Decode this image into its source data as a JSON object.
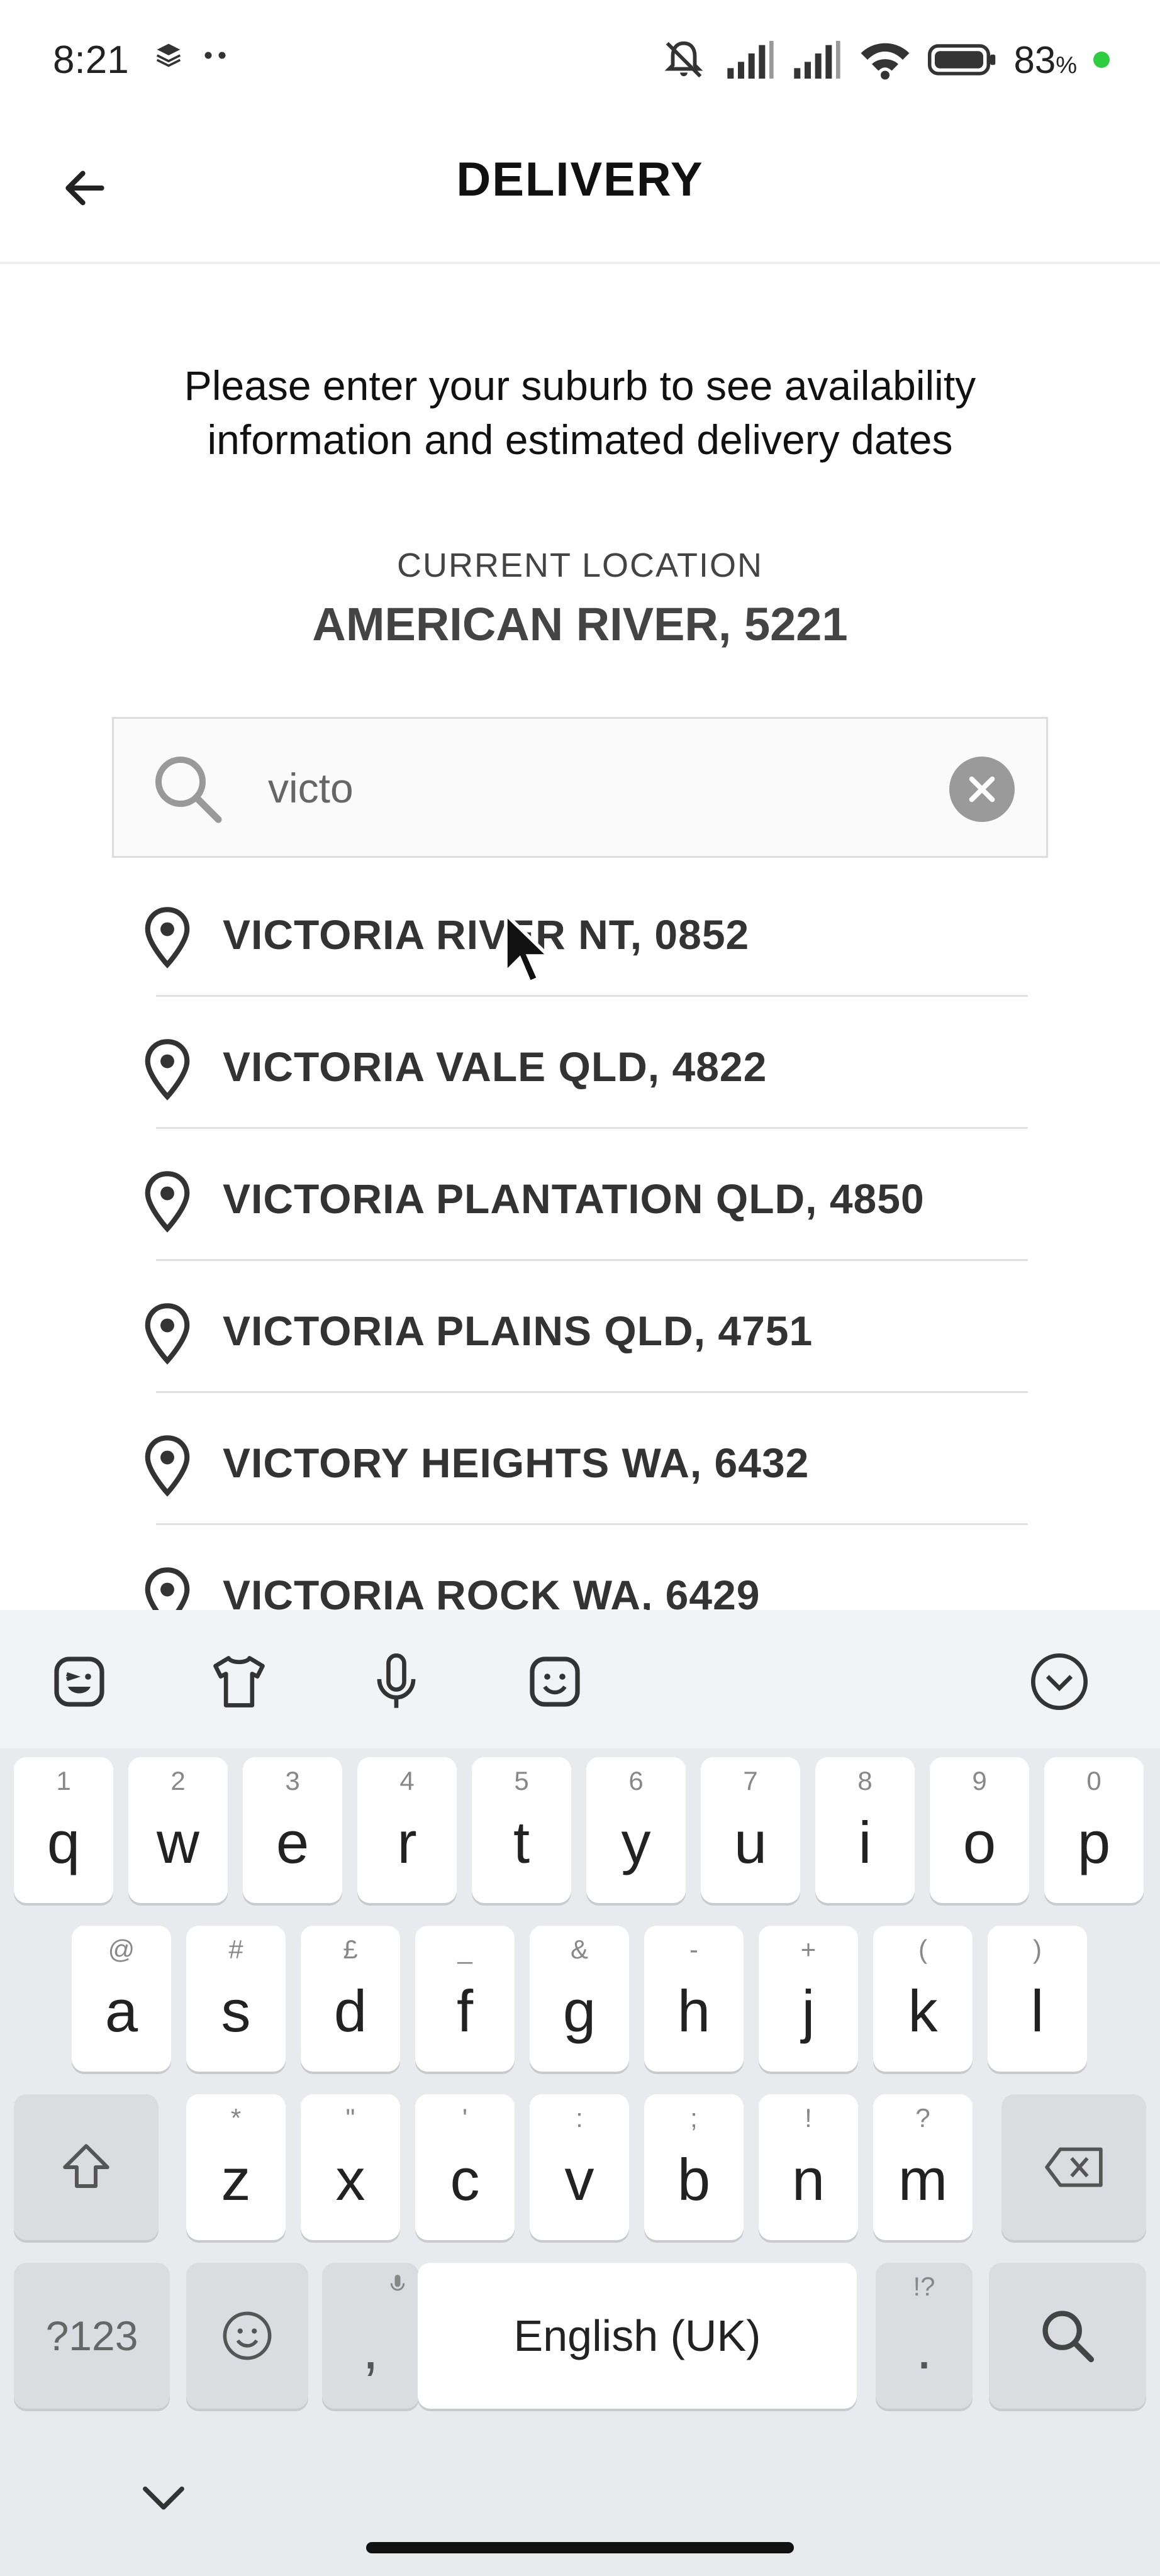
{
  "status_bar": {
    "time": "8:21",
    "battery": "83",
    "battery_unit": "%",
    "icons": [
      "layers-icon",
      "more-dots-icon",
      "mute-icon",
      "signal-icon",
      "signal-icon",
      "wifi-icon",
      "battery-icon"
    ]
  },
  "header": {
    "title": "DELIVERY",
    "back_icon": "arrow-left-icon"
  },
  "intro": {
    "text": "Please enter your suburb to see availability information and estimated delivery dates"
  },
  "current_location": {
    "label": "CURRENT LOCATION",
    "value": "AMERICAN RIVER, 5221"
  },
  "search": {
    "value": "victo",
    "placeholder": ""
  },
  "results": [
    {
      "label": "VICTORIA RIVER NT, 0852"
    },
    {
      "label": "VICTORIA VALE QLD, 4822"
    },
    {
      "label": "VICTORIA PLANTATION QLD, 4850"
    },
    {
      "label": "VICTORIA PLAINS QLD, 4751"
    },
    {
      "label": "VICTORY HEIGHTS WA, 6432"
    },
    {
      "label": "VICTORIA ROCK WA, 6429"
    }
  ],
  "keyboard": {
    "toolbar": [
      "sticker-icon",
      "clothing-icon",
      "microphone-icon",
      "emoji-icon",
      "collapse-icon"
    ],
    "row1": [
      {
        "key": "q",
        "hint": "1"
      },
      {
        "key": "w",
        "hint": "2"
      },
      {
        "key": "e",
        "hint": "3"
      },
      {
        "key": "r",
        "hint": "4"
      },
      {
        "key": "t",
        "hint": "5"
      },
      {
        "key": "y",
        "hint": "6"
      },
      {
        "key": "u",
        "hint": "7"
      },
      {
        "key": "i",
        "hint": "8"
      },
      {
        "key": "o",
        "hint": "9"
      },
      {
        "key": "p",
        "hint": "0"
      }
    ],
    "row2": [
      {
        "key": "a",
        "hint": "@"
      },
      {
        "key": "s",
        "hint": "#"
      },
      {
        "key": "d",
        "hint": "£"
      },
      {
        "key": "f",
        "hint": "_"
      },
      {
        "key": "g",
        "hint": "&"
      },
      {
        "key": "h",
        "hint": "-"
      },
      {
        "key": "j",
        "hint": "+"
      },
      {
        "key": "k",
        "hint": "("
      },
      {
        "key": "l",
        "hint": ")"
      }
    ],
    "row3": [
      {
        "key": "z",
        "hint": "*"
      },
      {
        "key": "x",
        "hint": "\""
      },
      {
        "key": "c",
        "hint": "'"
      },
      {
        "key": "v",
        "hint": ":"
      },
      {
        "key": "b",
        "hint": ";"
      },
      {
        "key": "n",
        "hint": "!"
      },
      {
        "key": "m",
        "hint": "?"
      }
    ],
    "symbols_label": "?123",
    "comma": ",",
    "space_label": "English (UK)",
    "period": ".",
    "period_hint": "!?"
  }
}
